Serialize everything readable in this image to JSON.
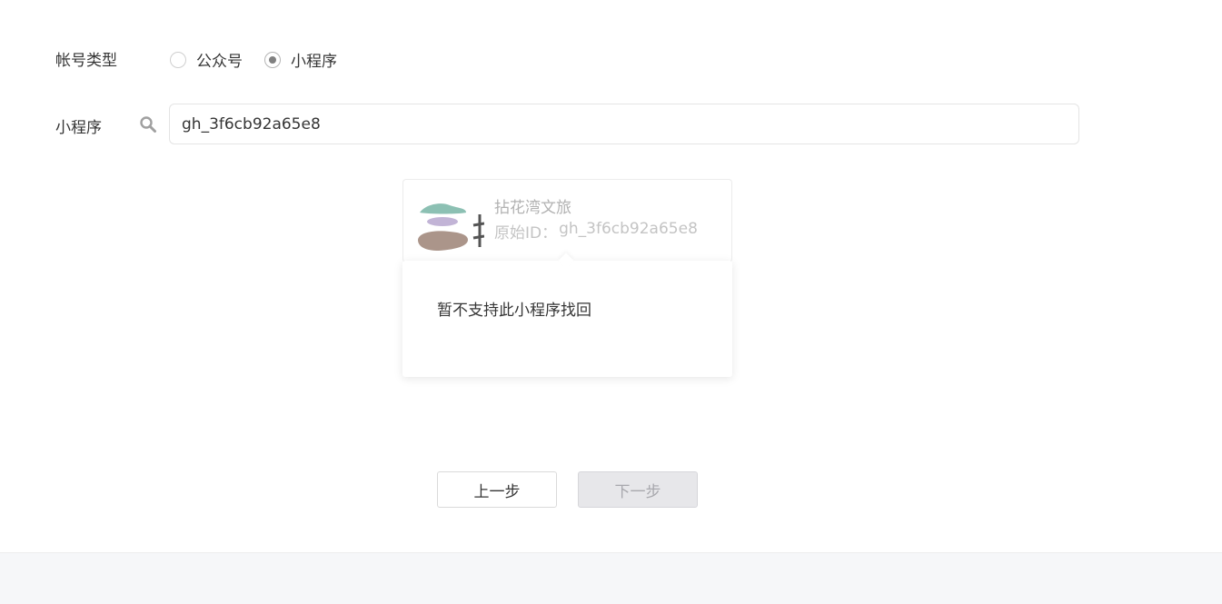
{
  "account_type": {
    "label": "帐号类型",
    "options": [
      {
        "label": "公众号",
        "checked": false
      },
      {
        "label": "小程序",
        "checked": true
      }
    ]
  },
  "miniprogram": {
    "label": "小程序",
    "search_icon": "search-icon",
    "search_value": "gh_3f6cb92a65e8"
  },
  "result": {
    "name": "拈花湾文旅",
    "id_label": "原始ID：",
    "id_value": "gh_3f6cb92a65e8"
  },
  "popover": {
    "message": "暂不支持此小程序找回"
  },
  "buttons": {
    "prev_label": "上一步",
    "next_label": "下一步"
  },
  "colors": {
    "text": "#353535",
    "muted": "#b2b2b2",
    "disabled_bg": "#e7e7ea",
    "footer_bg": "#f6f7f9"
  }
}
